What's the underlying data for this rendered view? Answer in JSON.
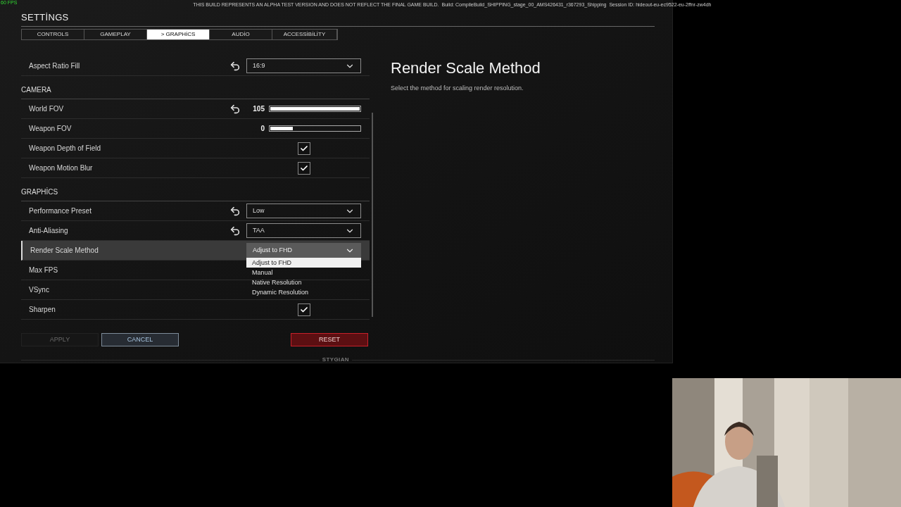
{
  "overlay": {
    "fps": "60 FPS",
    "notice": "THIS BUILD REPRESENTS AN ALPHA TEST VERSION AND DOES NOT REFLECT THE FINAL GAME BUILD.",
    "build": "Build: CompileBuild_SHIPPING_stage_00_AMS426431_r367293_Shipping",
    "session": "Session ID: hideout-eu-ec9522-eu-2ffnr-zw4dh"
  },
  "title": "SETTİNGS",
  "tabs": [
    {
      "label": "CONTROLS",
      "selected": false
    },
    {
      "label": "GAMEPLAY",
      "selected": false
    },
    {
      "label": "> GRAPHİCS",
      "selected": true
    },
    {
      "label": "AUDİO",
      "selected": false
    },
    {
      "label": "ACCESSİBİLİTY",
      "selected": false
    }
  ],
  "sections": [
    {
      "rows": [
        {
          "label": "Aspect Ratio Fill",
          "kind": "dropdown",
          "reset": true,
          "selected": false,
          "value": "16:9",
          "expanded": false
        }
      ]
    },
    {
      "heading": "CAMERA",
      "rows": [
        {
          "label": "World FOV",
          "kind": "slider",
          "reset": true,
          "selected": false,
          "value": "105",
          "level": 1
        },
        {
          "label": "Weapon FOV",
          "kind": "slider",
          "reset": false,
          "selected": false,
          "value": "0",
          "level": 0.25
        },
        {
          "label": "Weapon Depth of Field",
          "kind": "checkbox",
          "reset": false,
          "selected": false,
          "checked": true
        },
        {
          "label": "Weapon Motion Blur",
          "kind": "checkbox",
          "reset": false,
          "selected": false,
          "checked": true
        }
      ]
    },
    {
      "heading": "GRAPHİCS",
      "rows": [
        {
          "label": "Performance Preset",
          "kind": "dropdown",
          "reset": true,
          "selected": false,
          "value": "Low",
          "expanded": false
        },
        {
          "label": "Anti-Aliasing",
          "kind": "dropdown",
          "reset": true,
          "selected": false,
          "value": "TAA",
          "expanded": false
        },
        {
          "label": "Render Scale Method",
          "kind": "dropdown",
          "reset": false,
          "selected": true,
          "value": "Adjust to FHD",
          "expanded": true,
          "options": [
            {
              "label": "Adjust to FHD",
              "selected": true
            },
            {
              "label": "Manual",
              "selected": false
            },
            {
              "label": "Native Resolution",
              "selected": false
            },
            {
              "label": "Dynamic Resolution",
              "selected": false
            }
          ]
        },
        {
          "label": "Max FPS",
          "kind": "plain",
          "reset": false,
          "selected": false
        },
        {
          "label": "VSync",
          "kind": "plain",
          "reset": false,
          "selected": false
        },
        {
          "label": "Sharpen",
          "kind": "checkbox",
          "reset": false,
          "selected": false,
          "checked": true
        }
      ]
    }
  ],
  "detail": {
    "title": "Render Scale Method",
    "description": "Select the method for scaling render resolution."
  },
  "buttons": [
    {
      "label": "APPLY",
      "kind": "apply",
      "disabled": true
    },
    {
      "label": "CANCEL",
      "kind": "cancel",
      "disabled": false
    },
    {
      "label": "RESET",
      "kind": "reset",
      "disabled": false
    }
  ],
  "footer": {
    "logo": "STYGIAN"
  }
}
